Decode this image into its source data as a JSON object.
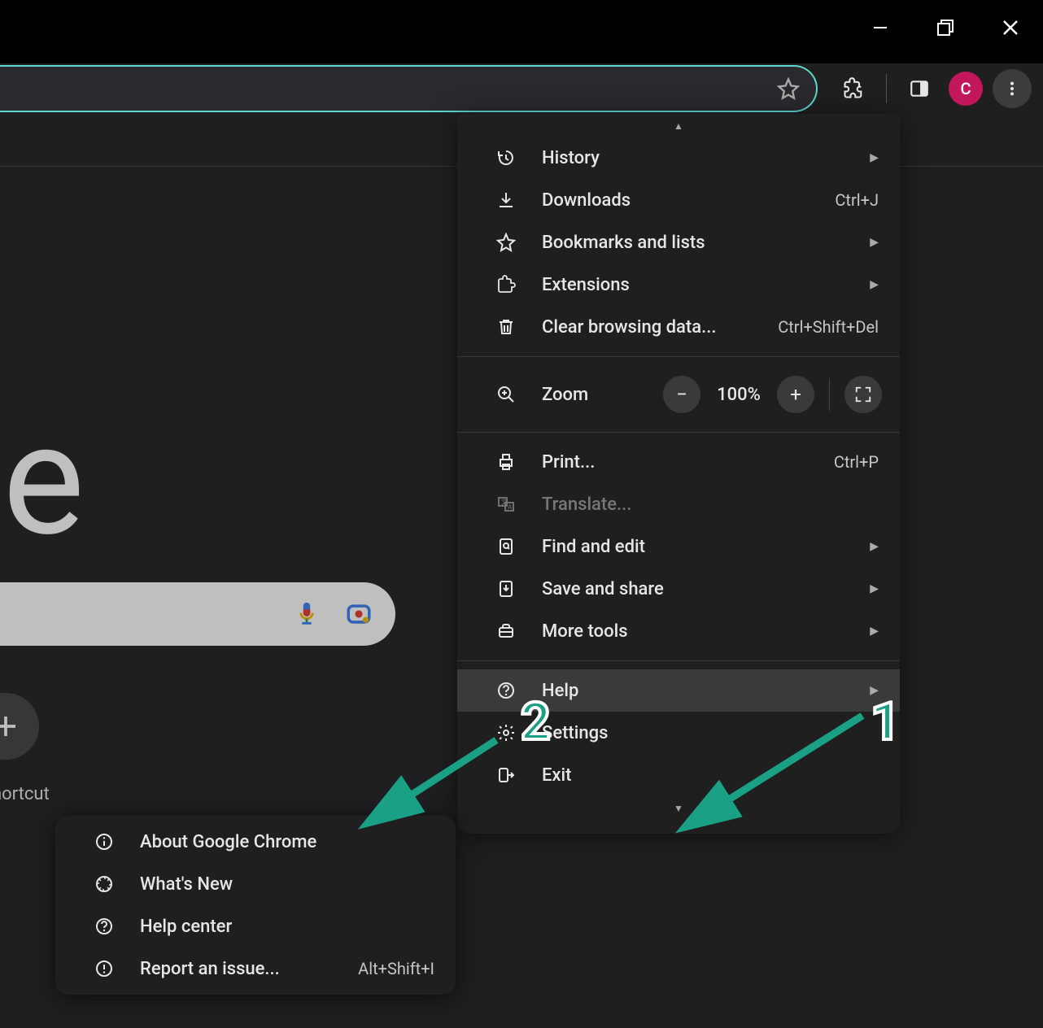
{
  "window": {},
  "toolbar": {
    "avatar_letter": "C"
  },
  "page": {
    "logo_fragment": "ogle",
    "shortcut_label": "hortcut"
  },
  "menu": {
    "items": [
      {
        "icon": "history-icon",
        "label": "History",
        "shortcut": "",
        "submenu": true
      },
      {
        "icon": "download-icon",
        "label": "Downloads",
        "shortcut": "Ctrl+J",
        "submenu": false
      },
      {
        "icon": "star-icon",
        "label": "Bookmarks and lists",
        "shortcut": "",
        "submenu": true
      },
      {
        "icon": "extension-icon",
        "label": "Extensions",
        "shortcut": "",
        "submenu": true
      },
      {
        "icon": "trash-icon",
        "label": "Clear browsing data...",
        "shortcut": "Ctrl+Shift+Del",
        "submenu": false
      }
    ],
    "zoom": {
      "label": "Zoom",
      "value": "100%"
    },
    "items2": [
      {
        "icon": "print-icon",
        "label": "Print...",
        "shortcut": "Ctrl+P",
        "submenu": false
      },
      {
        "icon": "translate-icon",
        "label": "Translate...",
        "shortcut": "",
        "submenu": false,
        "disabled": true
      },
      {
        "icon": "find-icon",
        "label": "Find and edit",
        "shortcut": "",
        "submenu": true
      },
      {
        "icon": "save-share-icon",
        "label": "Save and share",
        "shortcut": "",
        "submenu": true
      },
      {
        "icon": "tools-icon",
        "label": "More tools",
        "shortcut": "",
        "submenu": true
      }
    ],
    "items3": [
      {
        "icon": "help-icon",
        "label": "Help",
        "shortcut": "",
        "submenu": true,
        "hover": true
      },
      {
        "icon": "settings-icon",
        "label": "Settings",
        "shortcut": "",
        "submenu": false
      },
      {
        "icon": "exit-icon",
        "label": "Exit",
        "shortcut": "",
        "submenu": false
      }
    ]
  },
  "submenu": {
    "items": [
      {
        "icon": "info-icon",
        "label": "About Google Chrome",
        "shortcut": ""
      },
      {
        "icon": "whatsnew-icon",
        "label": "What's New",
        "shortcut": ""
      },
      {
        "icon": "helpcenter-icon",
        "label": "Help center",
        "shortcut": ""
      },
      {
        "icon": "report-icon",
        "label": "Report an issue...",
        "shortcut": "Alt+Shift+I"
      }
    ]
  },
  "annotations": {
    "one": "1",
    "two": "2"
  }
}
